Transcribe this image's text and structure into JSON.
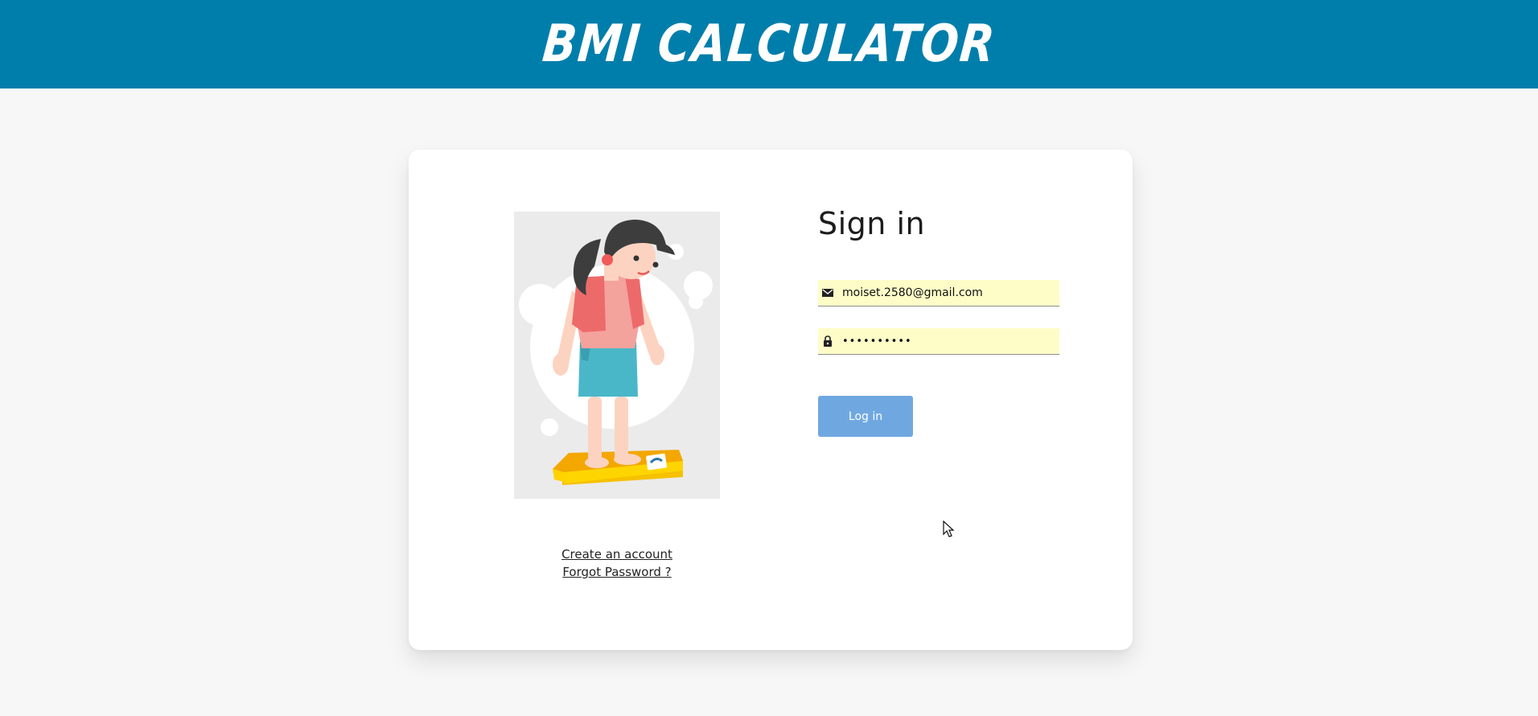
{
  "header": {
    "title": "BMI CALCULATOR",
    "background_color": "#007eab"
  },
  "login": {
    "title": "Sign in",
    "email": {
      "icon": "envelope-icon",
      "value": "moiset.2580@gmail.com"
    },
    "password": {
      "icon": "lock-icon",
      "value": "••••••••••"
    },
    "submit_label": "Log in",
    "button_color": "#6fa8e0",
    "field_color": "#fefdc8"
  },
  "links": {
    "create_account": "Create an account",
    "forgot_password": "Forgot Password ?"
  },
  "illustration": {
    "icon": "woman-on-scale-illustration"
  }
}
